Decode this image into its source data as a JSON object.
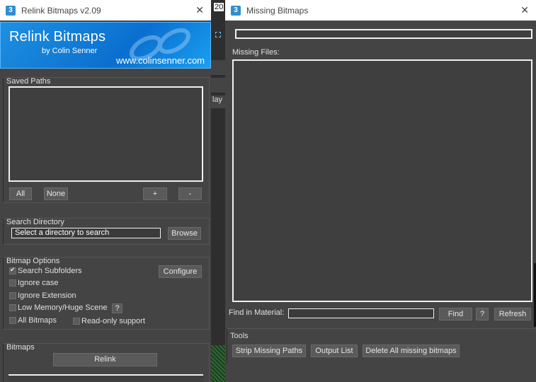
{
  "background": {
    "top_text": "20",
    "tab_text": "lay"
  },
  "relink": {
    "title": "Relink Bitmaps v2.09",
    "banner": {
      "title": "Relink Bitmaps",
      "subtitle": "by Colin Senner",
      "url": "www.colinsenner.com"
    },
    "saved_paths": {
      "label": "Saved Paths",
      "all_label": "All",
      "none_label": "None",
      "add_label": "+",
      "remove_label": "-"
    },
    "search_directory": {
      "label": "Search Directory",
      "value": "Select a directory to search",
      "browse_label": "Browse"
    },
    "bitmap_options": {
      "label": "Bitmap Options",
      "search_subfolders": "Search Subfolders",
      "search_subfolders_checked": true,
      "ignore_case": "Ignore case",
      "ignore_extension": "Ignore Extension",
      "low_memory": "Low Memory/Huge Scene",
      "help_label": "?",
      "all_bitmaps": "All Bitmaps",
      "readonly_support": "Read-only support",
      "configure_label": "Configure"
    },
    "bitmaps": {
      "label": "Bitmaps",
      "relink_label": "Relink"
    }
  },
  "missing": {
    "title": "Missing Bitmaps",
    "missing_files_label": "Missing Files:",
    "find_in_material_label": "Find in Material:",
    "find_label": "Find",
    "help_label": "?",
    "refresh_label": "Refresh",
    "tools_label": "Tools",
    "strip_label": "Strip Missing Paths",
    "output_label": "Output List",
    "delete_label": "Delete All missing bitmaps"
  },
  "icons": {
    "app_icon_glyph": "3",
    "close_glyph": "✕"
  }
}
